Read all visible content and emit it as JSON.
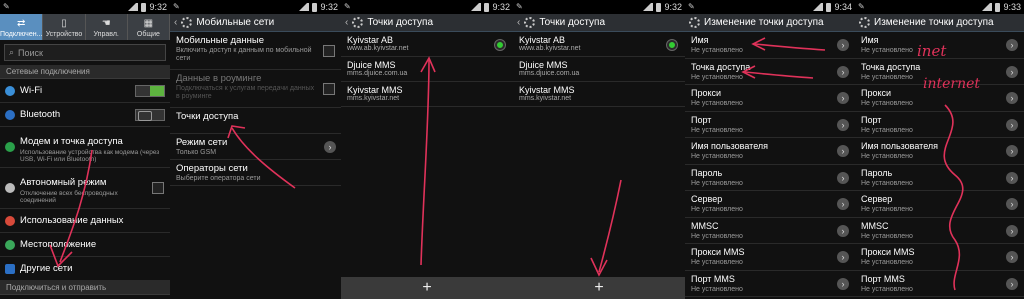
{
  "time1": "9:32",
  "time2": "9:32",
  "time3": "9:32",
  "time4": "9:32",
  "time5": "9:34",
  "time6": "9:33",
  "p1": {
    "tabs": [
      {
        "label": "Подключен...",
        "icon": "swap-icon"
      },
      {
        "label": "Устройство",
        "icon": "phone-icon"
      },
      {
        "label": "Управл.",
        "icon": "hand-icon"
      },
      {
        "label": "Общие",
        "icon": "grid-icon"
      }
    ],
    "search_placeholder": "Поиск",
    "section1": "Сетевые подключения",
    "wifi": "Wi-Fi",
    "bluetooth": "Bluetooth",
    "modem_title": "Модем и точка доступа",
    "modem_sub": "Использование устройства как модема (через USB, Wi-Fi или Bluetooth)",
    "airplane_title": "Автономный режим",
    "airplane_sub": "Отключение всех беспроводных соединений",
    "data_usage": "Использование данных",
    "location": "Местоположение",
    "other_networks": "Другие сети",
    "section2": "Подключиться и отправить"
  },
  "p2": {
    "title": "Мобильные сети",
    "items": [
      {
        "t": "Мобильные данные",
        "s": "Включить доступ к данным по мобильной сети"
      },
      {
        "t": "Данные в роуминге",
        "s": "Подключаться к услугам передачи данных в роуминге"
      },
      {
        "t": "Точки доступа",
        "s": ""
      },
      {
        "t": "Режим сети",
        "s": "Только GSM"
      },
      {
        "t": "Операторы сети",
        "s": "Выберите оператора сети"
      }
    ]
  },
  "p3": {
    "title": "Точки доступа",
    "items": [
      {
        "t": "Kyivstar AB",
        "s": "www.ab.kyivstar.net"
      },
      {
        "t": "Djuice MMS",
        "s": "mms.djuice.com.ua"
      },
      {
        "t": "Kyivstar MMS",
        "s": "mms.kyivstar.net"
      }
    ],
    "add": "+"
  },
  "p4": {
    "title": "Точки доступа",
    "items": [
      {
        "t": "Kyivstar AB",
        "s": "www.ab.kyivstar.net"
      },
      {
        "t": "Djuice MMS",
        "s": "mms.djuice.com.ua"
      },
      {
        "t": "Kyivstar MMS",
        "s": "mms.kyivstar.net"
      }
    ],
    "add": "+"
  },
  "p5": {
    "title": "Изменение точки доступа",
    "fields": [
      {
        "t": "Имя",
        "s": "Не установлено"
      },
      {
        "t": "Точка доступа",
        "s": "Не установлено"
      },
      {
        "t": "Прокси",
        "s": "Не установлено"
      },
      {
        "t": "Порт",
        "s": "Не установлено"
      },
      {
        "t": "Имя пользователя",
        "s": "Не установлено"
      },
      {
        "t": "Пароль",
        "s": "Не установлено"
      },
      {
        "t": "Сервер",
        "s": "Не установлено"
      },
      {
        "t": "MMSC",
        "s": "Не установлено"
      },
      {
        "t": "Прокси MMS",
        "s": "Не установлено"
      },
      {
        "t": "Порт MMS",
        "s": "Не установлено"
      }
    ]
  },
  "p6": {
    "title": "Изменение точки доступа",
    "fields": [
      {
        "t": "Имя",
        "s": "Не установлено"
      },
      {
        "t": "Точка доступа",
        "s": "Не установлено"
      },
      {
        "t": "Прокси",
        "s": "Не установлено"
      },
      {
        "t": "Порт",
        "s": "Не установлено"
      },
      {
        "t": "Имя пользователя",
        "s": "Не установлено"
      },
      {
        "t": "Пароль",
        "s": "Не установлено"
      },
      {
        "t": "Сервер",
        "s": "Не установлено"
      },
      {
        "t": "MMSC",
        "s": "Не установлено"
      },
      {
        "t": "Прокси MMS",
        "s": "Не установлено"
      },
      {
        "t": "Порт MMS",
        "s": "Не установлено"
      }
    ],
    "hand_name": "inet",
    "hand_ap": "internet"
  },
  "colors": {
    "accent": "#5a8fbf",
    "annotation": "#e0325a",
    "toggle_on": "#5db33f"
  }
}
